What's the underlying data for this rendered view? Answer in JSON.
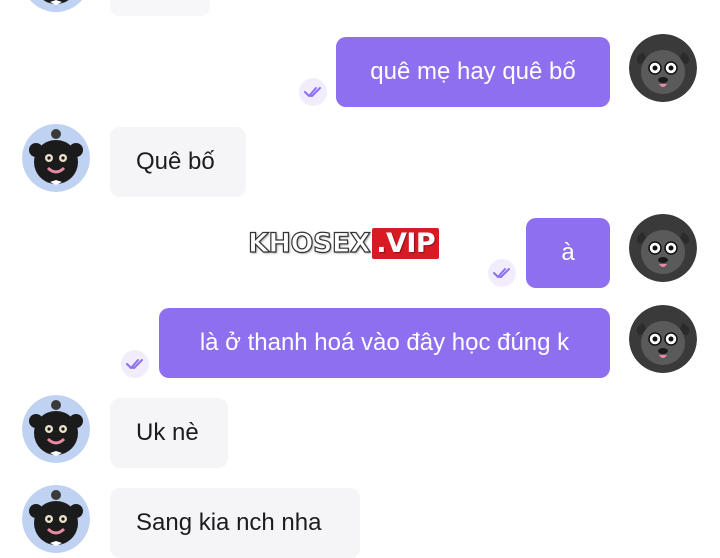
{
  "watermark": {
    "part1": "KHOSEX",
    "part2": ".VIP"
  },
  "messages": [
    {
      "side": "out",
      "text": "quê mẹ hay quê bố"
    },
    {
      "side": "in",
      "text": "Quê bố"
    },
    {
      "side": "out",
      "text": "à"
    },
    {
      "side": "out",
      "text": "là ở thanh hoá vào đây học đúng k"
    },
    {
      "side": "in",
      "text": "Uk nè"
    },
    {
      "side": "in",
      "text": "Sang kia nch nha"
    }
  ],
  "icons": {
    "sent_status": "double-check-icon",
    "self_avatar": "gray-bear-avatar",
    "contact_avatar": "black-bear-avatar"
  },
  "colors": {
    "outgoing_bubble": "#8d6ff0",
    "incoming_bubble": "#f5f5f8",
    "check_icon": "#8d6ff0",
    "contact_avatar_bg": "#bfd2f2",
    "self_avatar_bg": "#3a3a3a"
  }
}
